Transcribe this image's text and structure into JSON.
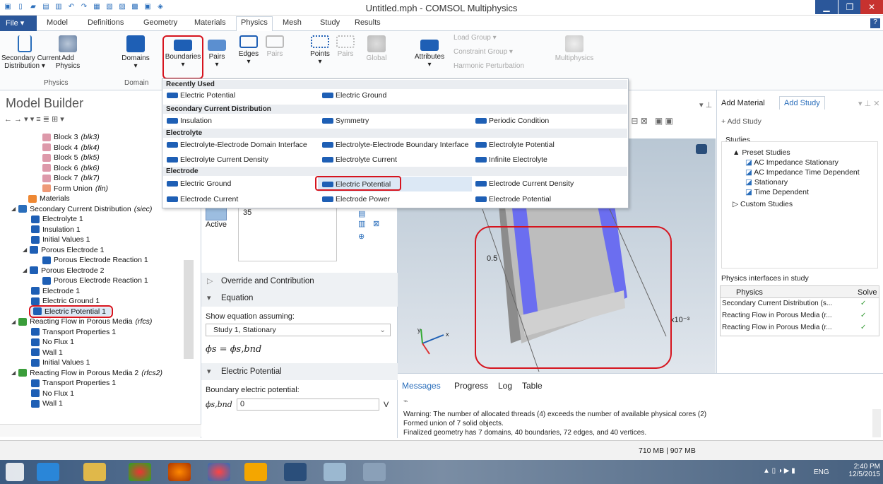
{
  "window": {
    "title": "Untitled.mph - COMSOL Multiphysics",
    "help": "?"
  },
  "menu": {
    "file": "File ▾",
    "tabs": [
      "Model",
      "Definitions",
      "Geometry",
      "Materials",
      "Physics",
      "Mesh",
      "Study",
      "Results"
    ]
  },
  "ribbon": {
    "buttons": [
      {
        "label": "Secondary Current\nDistribution ▾"
      },
      {
        "label": "Add\nPhysics"
      },
      {
        "label": "Domains\n▾"
      },
      {
        "label": "Boundaries\n▾"
      },
      {
        "label": "Pairs\n▾"
      },
      {
        "label": "Edges\n▾"
      },
      {
        "label": "Pairs"
      },
      {
        "label": "Points\n▾"
      },
      {
        "label": "Pairs"
      },
      {
        "label": "Global"
      },
      {
        "label": "Attributes\n▾"
      },
      {
        "label": "Multiphysics"
      }
    ],
    "small_items": [
      "Load Group ▾",
      "Constraint Group ▾",
      "Harmonic Perturbation"
    ],
    "groups": [
      "Physics",
      "Domain"
    ]
  },
  "model_builder": {
    "title": "Model Builder",
    "tree": [
      {
        "label": "Block 3",
        "tag": "(blk3)"
      },
      {
        "label": "Block 4",
        "tag": "(blk4)"
      },
      {
        "label": "Block 5",
        "tag": "(blk5)"
      },
      {
        "label": "Block 6",
        "tag": "(blk6)"
      },
      {
        "label": "Block 7",
        "tag": "(blk7)"
      },
      {
        "label": "Form Union",
        "tag": "(fin)"
      },
      {
        "label": "Materials",
        "tag": ""
      },
      {
        "label": "Secondary Current Distribution",
        "tag": "(siec)"
      },
      {
        "label": "Electrolyte 1",
        "tag": ""
      },
      {
        "label": "Insulation 1",
        "tag": ""
      },
      {
        "label": "Initial Values 1",
        "tag": ""
      },
      {
        "label": "Porous Electrode 1",
        "tag": ""
      },
      {
        "label": "Porous Electrode Reaction 1",
        "tag": ""
      },
      {
        "label": "Porous Electrode 2",
        "tag": ""
      },
      {
        "label": "Porous Electrode Reaction 1",
        "tag": ""
      },
      {
        "label": "Electrode 1",
        "tag": ""
      },
      {
        "label": "Electric Ground 1",
        "tag": ""
      },
      {
        "label": "Electric Potential 1",
        "tag": ""
      },
      {
        "label": "Reacting Flow in Porous Media",
        "tag": "(rfcs)"
      },
      {
        "label": "Transport Properties 1",
        "tag": ""
      },
      {
        "label": "No Flux 1",
        "tag": ""
      },
      {
        "label": "Wall 1",
        "tag": ""
      },
      {
        "label": "Initial Values 1",
        "tag": ""
      },
      {
        "label": "Reacting Flow in Porous Media 2",
        "tag": "(rfcs2)"
      },
      {
        "label": "Transport Properties 1",
        "tag": ""
      },
      {
        "label": "No Flux 1",
        "tag": ""
      },
      {
        "label": "Wall 1",
        "tag": ""
      }
    ]
  },
  "dropdown": {
    "sections": [
      "Recently Used",
      "Secondary Current Distribution",
      "Electrolyte",
      "Electrode"
    ],
    "recent": [
      "Electric Potential",
      "Electric Ground"
    ],
    "secondary": [
      "Insulation",
      "Symmetry",
      "Periodic Condition"
    ],
    "electrolyte": [
      "Electrolyte-Electrode Domain Interface",
      "Electrolyte-Electrode Boundary Interface",
      "Electrolyte Potential",
      "Electrolyte Current Density",
      "Electrolyte Current",
      "Infinite Electrolyte"
    ],
    "electrode": [
      "Electric Ground",
      "Electric Potential",
      "Electrode Current Density",
      "Electrode Current",
      "Electrode Power",
      "Electrode Potential"
    ]
  },
  "settings": {
    "selection_value": "35",
    "active_label": "Active",
    "override": "Override and Contribution",
    "equation": "Equation",
    "show_eq": "Show equation assuming:",
    "study": "Study 1, Stationary",
    "formula": "ϕs = ϕs,bnd",
    "ep_section": "Electric Potential",
    "bep_label": "Boundary electric potential:",
    "phi_label": "ϕs,bnd",
    "phi_value": "0",
    "unit": "V"
  },
  "graphics": {
    "label_05": "0.5",
    "exp": "x10⁻³",
    "axis_y": "y",
    "axis_x": "x"
  },
  "right": {
    "tabs": [
      "Add Material",
      "Add Study"
    ],
    "add_study": "+ Add Study",
    "studies_label": "Studies",
    "preset": "Preset Studies",
    "study_items": [
      "AC Impedance Stationary",
      "AC Impedance Time Dependent",
      "Stationary",
      "Time Dependent"
    ],
    "custom": "Custom Studies",
    "piis_label": "Physics interfaces in study",
    "col_physics": "Physics",
    "col_solve": "Solve",
    "interfaces": [
      "Secondary Current Distribution (s...",
      "Reacting Flow in Porous Media (r...",
      "Reacting Flow in Porous Media (r..."
    ]
  },
  "messages": {
    "tabs": [
      "Messages",
      "Progress",
      "Log",
      "Table"
    ],
    "lines": [
      "Warning: The number of allocated threads (4) exceeds the number of available physical cores (2)",
      "Formed union of 7 solid objects.",
      "Finalized geometry has 7 domains, 40 boundaries, 72 edges, and 40 vertices."
    ]
  },
  "status": {
    "memory": "710 MB | 907 MB"
  },
  "taskbar": {
    "lang": "ENG",
    "time": "2:40 PM",
    "date": "12/5/2015"
  },
  "colors": {
    "accent": "#2b579a",
    "highlight": "#d6141e",
    "boundary_blue": "#6b6ef0"
  }
}
